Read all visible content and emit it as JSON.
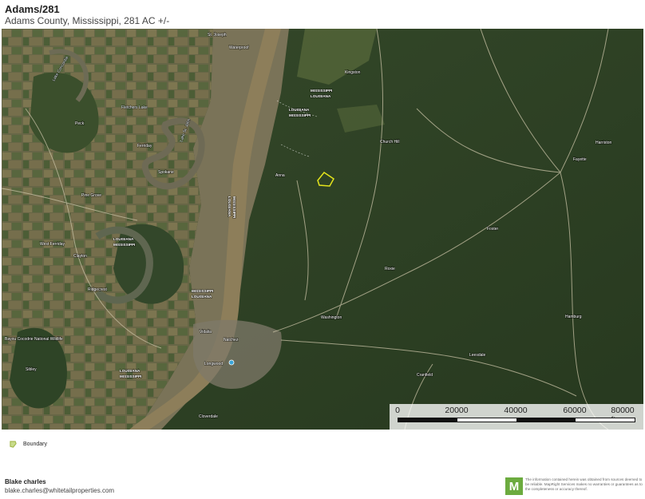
{
  "header": {
    "title": "Adams/281",
    "subtitle": "Adams County, Mississippi, 281 AC +/-"
  },
  "map": {
    "places": [
      "Ferriday",
      "Vidalia",
      "Natchez",
      "Church Hill",
      "Fayette",
      "Washington",
      "Cranfield",
      "Roxie",
      "Hamburg",
      "Leesdale",
      "Sibley",
      "Kingston",
      "Lake St. John",
      "Spokane",
      "Pine Grove",
      "West Ferriday",
      "Ridgecrest",
      "Clayton",
      "Anna",
      "Fletchers Lake",
      "Harriston",
      "Longwood",
      "Cloverdale",
      "Bayou Cocodrie National Wildlife",
      "Lake Concordia",
      "Waterproof",
      "St. Joseph",
      "Foster",
      "Peck"
    ],
    "state_labels": [
      "MISSISSIPPI",
      "LOUISIANA"
    ],
    "colors": {
      "boundary": "#e4e41c",
      "river": "#8d7e5a"
    }
  },
  "scale": {
    "ticks": [
      "0",
      "20000",
      "40000",
      "60000",
      "80000 ft"
    ]
  },
  "legend": {
    "icon": "boundary-swatch-icon",
    "label": "Boundary"
  },
  "agent": {
    "name": "Blake charles",
    "email": "blake.charles@whitetailproperties.com"
  },
  "disclaimer": {
    "logo": "M",
    "text": "The information contained herein was obtained from sources deemed to be reliable. MapRight Services makes no warranties or guarantees as to the completeness or accuracy thereof."
  }
}
